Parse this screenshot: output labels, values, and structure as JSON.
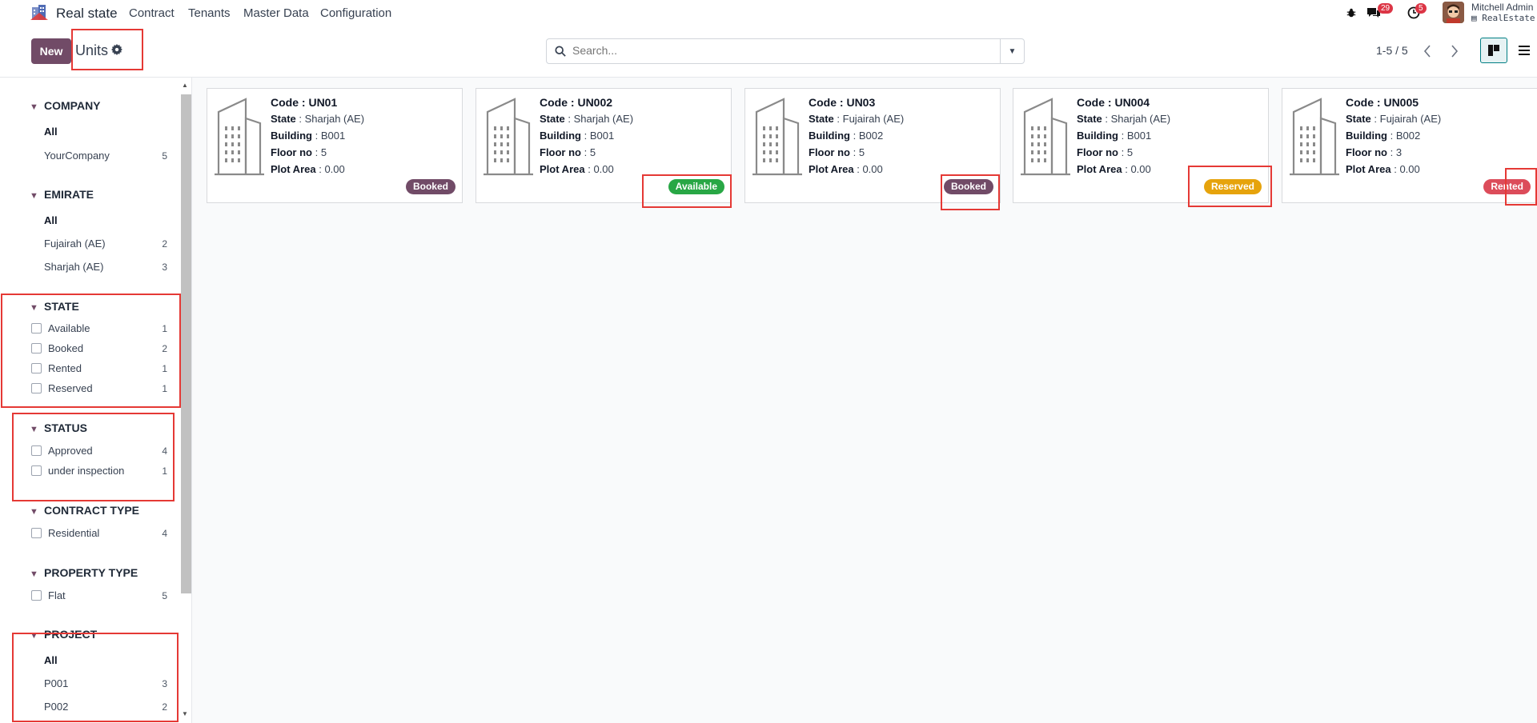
{
  "topbar": {
    "app_name": "Real state",
    "menu": [
      "Contract",
      "Tenants",
      "Master Data",
      "Configuration"
    ],
    "messages_count": "29",
    "activities_count": "5",
    "user_name": "Mitchell Admin",
    "database": "RealEstate"
  },
  "control": {
    "new_label": "New",
    "title": "Units",
    "search_placeholder": "Search...",
    "pager": "1-5 / 5"
  },
  "sidebar": {
    "company": {
      "title": "COMPANY",
      "all": "All",
      "items": [
        {
          "label": "YourCompany",
          "count": "5"
        }
      ]
    },
    "emirate": {
      "title": "EMIRATE",
      "all": "All",
      "items": [
        {
          "label": "Fujairah (AE)",
          "count": "2"
        },
        {
          "label": "Sharjah (AE)",
          "count": "3"
        }
      ]
    },
    "state": {
      "title": "STATE",
      "items": [
        {
          "label": "Available",
          "count": "1"
        },
        {
          "label": "Booked",
          "count": "2"
        },
        {
          "label": "Rented",
          "count": "1"
        },
        {
          "label": "Reserved",
          "count": "1"
        }
      ]
    },
    "status": {
      "title": "STATUS",
      "items": [
        {
          "label": "Approved",
          "count": "4"
        },
        {
          "label": "under inspection",
          "count": "1"
        }
      ]
    },
    "contract_type": {
      "title": "CONTRACT TYPE",
      "items": [
        {
          "label": "Residential",
          "count": "4"
        }
      ]
    },
    "property_type": {
      "title": "PROPERTY TYPE",
      "items": [
        {
          "label": "Flat",
          "count": "5"
        }
      ]
    },
    "project": {
      "title": "PROJECT",
      "all": "All",
      "items": [
        {
          "label": "P001",
          "count": "3"
        },
        {
          "label": "P002",
          "count": "2"
        }
      ]
    }
  },
  "labels": {
    "code": "Code",
    "state": "State",
    "building": "Building",
    "floor": "Floor no",
    "plot": "Plot Area"
  },
  "cards": [
    {
      "code": "UN01",
      "state": "Sharjah (AE)",
      "building": "B001",
      "floor": "5",
      "plot": "0.00",
      "tag": "Booked",
      "tag_color": "#714b67"
    },
    {
      "code": "UN002",
      "state": "Sharjah (AE)",
      "building": "B001",
      "floor": "5",
      "plot": "0.00",
      "tag": "Available",
      "tag_color": "#28a745"
    },
    {
      "code": "UN03",
      "state": "Fujairah (AE)",
      "building": "B002",
      "floor": "5",
      "plot": "0.00",
      "tag": "Booked",
      "tag_color": "#714b67"
    },
    {
      "code": "UN004",
      "state": "Sharjah (AE)",
      "building": "B001",
      "floor": "5",
      "plot": "0.00",
      "tag": "Reserved",
      "tag_color": "#e6a30c"
    },
    {
      "code": "UN005",
      "state": "Fujairah (AE)",
      "building": "B002",
      "floor": "3",
      "plot": "0.00",
      "tag": "Rented",
      "tag_color": "#dc4c5a"
    }
  ]
}
